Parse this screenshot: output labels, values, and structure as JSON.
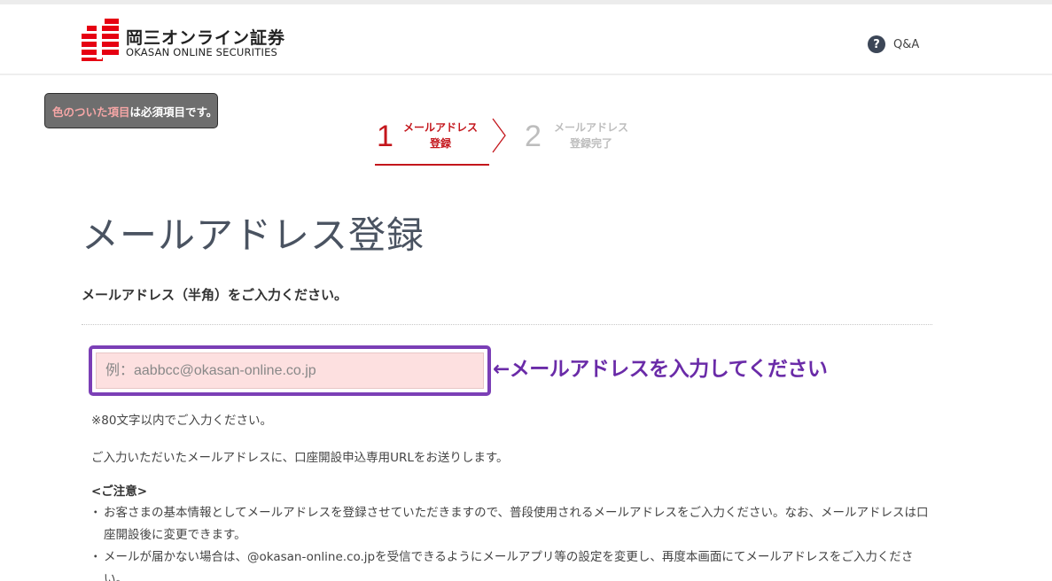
{
  "header": {
    "logo_jp": "岡三オンライン証券",
    "logo_en": "OKASAN ONLINE SECURITIES",
    "qa_icon": "question-circle-icon",
    "qa_label": "Q&A",
    "brand_color": "#e60012"
  },
  "required_note": {
    "highlight": "色のついた項目",
    "rest": "は必須項目です。"
  },
  "steps": [
    {
      "number": "1",
      "line1": "メールアドレス",
      "line2": "登録",
      "status": "active"
    },
    {
      "number": "2",
      "line1": "メールアドレス",
      "line2": "登録完了",
      "status": "inactive"
    }
  ],
  "colors": {
    "active_step": "#c4161c",
    "inactive_step": "#bdbdbd",
    "annotation": "#6a2ba8",
    "input_bg": "#fde0e0"
  },
  "page_title": "メールアドレス登録",
  "subtitle": "メールアドレス（半角）をご入力ください。",
  "email": {
    "placeholder": "例：aabbcc@okasan-online.co.jp",
    "value": ""
  },
  "annotation": "←メールアドレスを入力してください",
  "hint": "※80文字以内でご入力ください。",
  "info": "ご入力いただいたメールアドレスに、口座開設申込専用URLをお送りします。",
  "notes": {
    "heading": "<ご注意>",
    "items": [
      "お客さまの基本情報としてメールアドレスを登録させていただきますので、普段使用されるメールアドレスをご入力ください。なお、メールアドレスは口座開設後に変更できます。",
      "メールが届かない場合は、@okasan-online.co.jpを受信できるようにメールアプリ等の設定を変更し、再度本画面にてメールアドレスをご入力ください。"
    ]
  }
}
